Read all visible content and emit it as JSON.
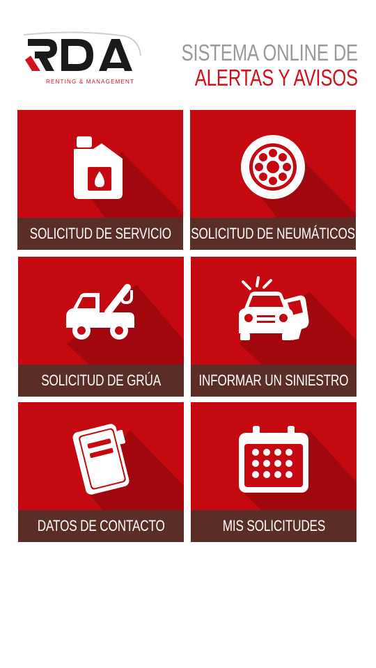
{
  "header": {
    "logo_text": "RDA",
    "logo_subtitle": "RENTING & MANAGEMENT",
    "tagline_line1": "SISTEMA ONLINE DE",
    "tagline_line2": "ALERTAS Y AVISOS"
  },
  "colors": {
    "tile_red": "#c40a10",
    "label_brown": "#5a2e26",
    "tagline_grey": "#9a9a9a",
    "tagline_red": "#d0121a"
  },
  "tiles": [
    {
      "label": "SOLICITUD DE SERVICIO",
      "icon": "oil-can-icon"
    },
    {
      "label": "SOLICITUD DE NEUMÁTICOS",
      "icon": "tire-icon"
    },
    {
      "label": "SOLICITUD DE GRÚA",
      "icon": "tow-truck-icon"
    },
    {
      "label": "INFORMAR UN SINIESTRO",
      "icon": "car-crash-icon"
    },
    {
      "label": "DATOS DE CONTACTO",
      "icon": "notebook-icon"
    },
    {
      "label": "MIS SOLICITUDES",
      "icon": "calendar-icon"
    }
  ]
}
